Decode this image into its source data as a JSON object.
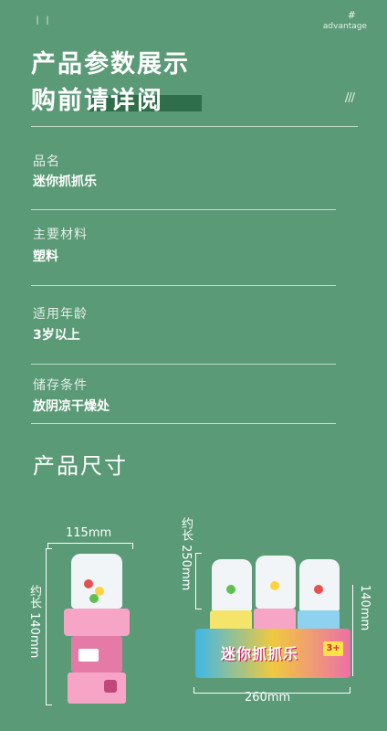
{
  "header": {
    "top_mark": "丨丨",
    "hash": "#",
    "advantage": "advantage",
    "title_line1": "产品参数展示",
    "title_line2": "购前请详阅",
    "slashes": "///"
  },
  "specs": [
    {
      "label": "品名",
      "value": "迷你抓抓乐"
    },
    {
      "label": "主要材料",
      "value": "塑料"
    },
    {
      "label": "适用年龄",
      "value": "3岁以上"
    },
    {
      "label": "储存条件",
      "value": "放阴凉干燥处"
    }
  ],
  "size_section": {
    "title": "产品尺寸",
    "single": {
      "width": "115mm",
      "height": "约长 140mm"
    },
    "box": {
      "length": "约长 250mm",
      "height": "140mm",
      "width": "260mm",
      "brand_text": "迷你抓抓乐",
      "age_badge": "3+"
    }
  },
  "colors": {
    "background": "#5a9a76",
    "title_bar": "#2f6e4a",
    "toy_pink": "#f6a5c7"
  }
}
